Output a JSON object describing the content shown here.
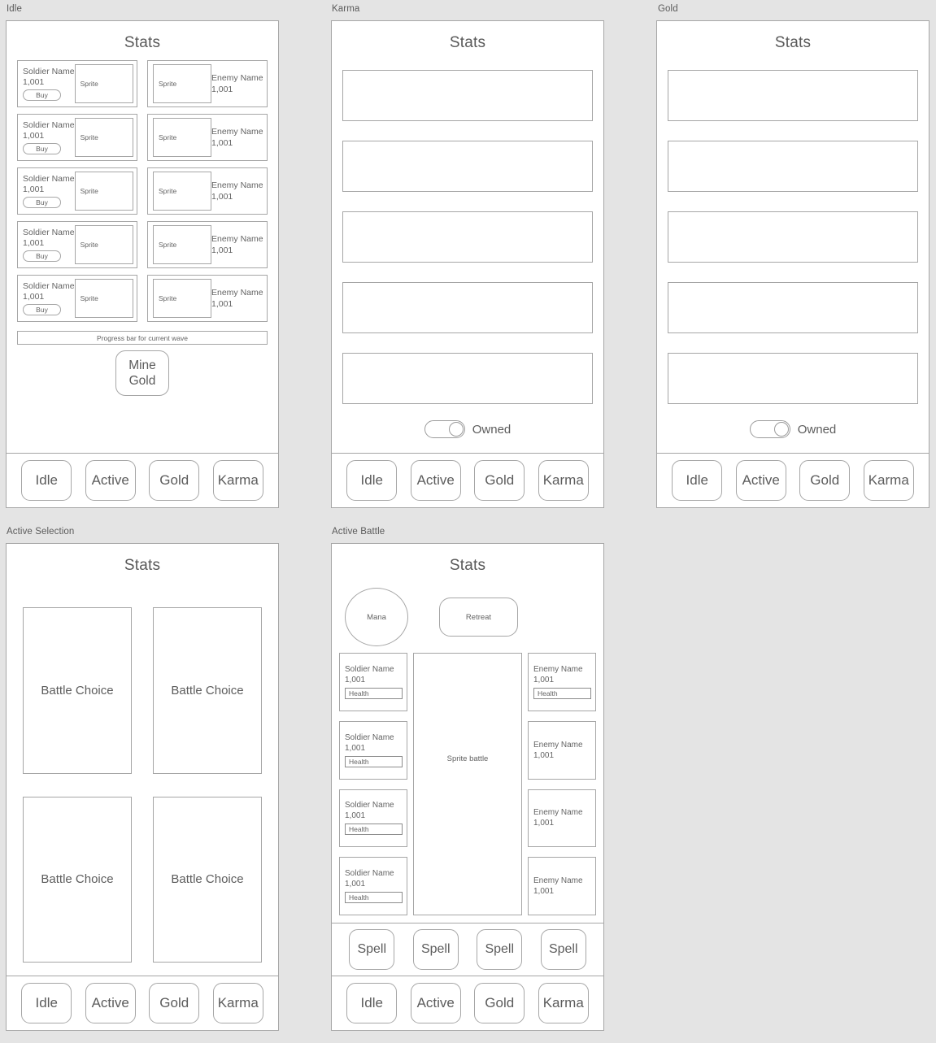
{
  "background_color": "#e4e4e4",
  "border_color": "#a6a6a6",
  "text_color": "#595959",
  "common": {
    "stats_title": "Stats",
    "nav": [
      "Idle",
      "Active",
      "Gold",
      "Karma"
    ],
    "soldier_name": "Soldier Name",
    "enemy_name": "Enemy Name",
    "unit_value": "1,001",
    "buy_label": "Buy",
    "sprite_label": "Sprite",
    "health_label": "Health",
    "owned_label": "Owned"
  },
  "panels": {
    "idle": {
      "label": "Idle",
      "title": "Stats",
      "rows": [
        {
          "soldier": {
            "name": "Soldier Name",
            "value": "1,001",
            "buy": "Buy",
            "sprite": "Sprite"
          },
          "enemy": {
            "name": "Enemy Name",
            "value": "1,001",
            "sprite": "Sprite"
          }
        },
        {
          "soldier": {
            "name": "Soldier Name",
            "value": "1,001",
            "buy": "Buy",
            "sprite": "Sprite"
          },
          "enemy": {
            "name": "Enemy Name",
            "value": "1,001",
            "sprite": "Sprite"
          }
        },
        {
          "soldier": {
            "name": "Soldier Name",
            "value": "1,001",
            "buy": "Buy",
            "sprite": "Sprite"
          },
          "enemy": {
            "name": "Enemy Name",
            "value": "1,001",
            "sprite": "Sprite"
          }
        },
        {
          "soldier": {
            "name": "Soldier Name",
            "value": "1,001",
            "buy": "Buy",
            "sprite": "Sprite"
          },
          "enemy": {
            "name": "Enemy Name",
            "value": "1,001",
            "sprite": "Sprite"
          }
        },
        {
          "soldier": {
            "name": "Soldier Name",
            "value": "1,001",
            "buy": "Buy",
            "sprite": "Sprite"
          },
          "enemy": {
            "name": "Enemy Name",
            "value": "1,001",
            "sprite": "Sprite"
          }
        }
      ],
      "progress_label": "Progress bar for current wave",
      "mine_line1": "Mine",
      "mine_line2": "Gold",
      "nav": [
        "Idle",
        "Active",
        "Gold",
        "Karma"
      ]
    },
    "karma": {
      "label": "Karma",
      "title": "Stats",
      "box_count": 5,
      "owned_label": "Owned",
      "toggle_state": "on",
      "nav": [
        "Idle",
        "Active",
        "Gold",
        "Karma"
      ]
    },
    "gold": {
      "label": "Gold",
      "title": "Stats",
      "box_count": 5,
      "owned_label": "Owned",
      "toggle_state": "on",
      "nav": [
        "Idle",
        "Active",
        "Gold",
        "Karma"
      ]
    },
    "active_selection": {
      "label": "Active Selection",
      "title": "Stats",
      "choices": [
        "Battle Choice",
        "Battle Choice",
        "Battle Choice",
        "Battle Choice"
      ],
      "nav": [
        "Idle",
        "Active",
        "Gold",
        "Karma"
      ]
    },
    "active_battle": {
      "label": "Active Battle",
      "title": "Stats",
      "mana_label": "Mana",
      "retreat_label": "Retreat",
      "sprite_battle_label": "Sprite battle",
      "soldiers": [
        {
          "name": "Soldier Name",
          "value": "1,001",
          "health": "Health"
        },
        {
          "name": "Soldier Name",
          "value": "1,001",
          "health": "Health"
        },
        {
          "name": "Soldier Name",
          "value": "1,001",
          "health": "Health"
        },
        {
          "name": "Soldier Name",
          "value": "1,001",
          "health": "Health"
        }
      ],
      "enemies": [
        {
          "name": "Enemy Name",
          "value": "1,001",
          "health": "Health"
        },
        {
          "name": "Enemy Name",
          "value": "1,001",
          "health": null
        },
        {
          "name": "Enemy Name",
          "value": "1,001",
          "health": null
        },
        {
          "name": "Enemy Name",
          "value": "1,001",
          "health": null
        }
      ],
      "spells": [
        "Spell",
        "Spell",
        "Spell",
        "Spell"
      ],
      "nav": [
        "Idle",
        "Active",
        "Gold",
        "Karma"
      ]
    }
  }
}
